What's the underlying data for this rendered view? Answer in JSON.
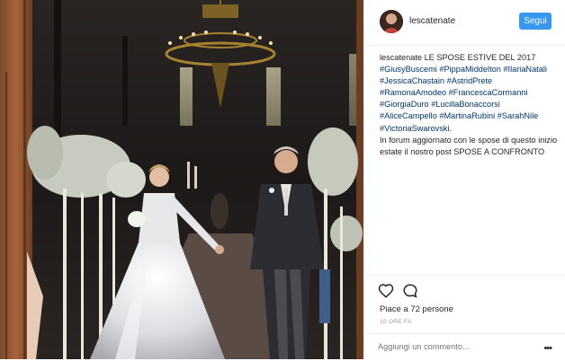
{
  "post": {
    "username": "lescatenate",
    "follow_label": "Segui",
    "caption_user": "lescatenate",
    "caption_title": "LE SPOSE ESTIVE DEL 2017",
    "hashtags": [
      "#GiusyBuscemi",
      "#PippaMiddelton",
      "#IlariaNatali",
      "#JessicaChastain",
      "#AstridPrete",
      "#RamonaAmodeo",
      "#FrancescaCormanni",
      "#GiorgiaDuro",
      "#LucillaBonaccorsi",
      "#AliceCampello",
      "#MartinaRubini",
      "#SarahNile",
      "#VictoriaSwarovski."
    ],
    "caption_text": "In forum aggiornato con le spose di questo inizio estate il nostro post SPOSE A CONFRONTO",
    "likes_label": "Piace a 72 persone",
    "time_label": "10 ORE FA",
    "comment_placeholder": "Aggiungi un commento...",
    "more_label": "•••"
  },
  "icons": {
    "like": "heart-icon",
    "comment": "comment-icon",
    "more": "more-options-icon"
  },
  "colors": {
    "follow_button": "#3897f0",
    "hashtag": "#003569",
    "text": "#262626",
    "muted": "#999999"
  }
}
